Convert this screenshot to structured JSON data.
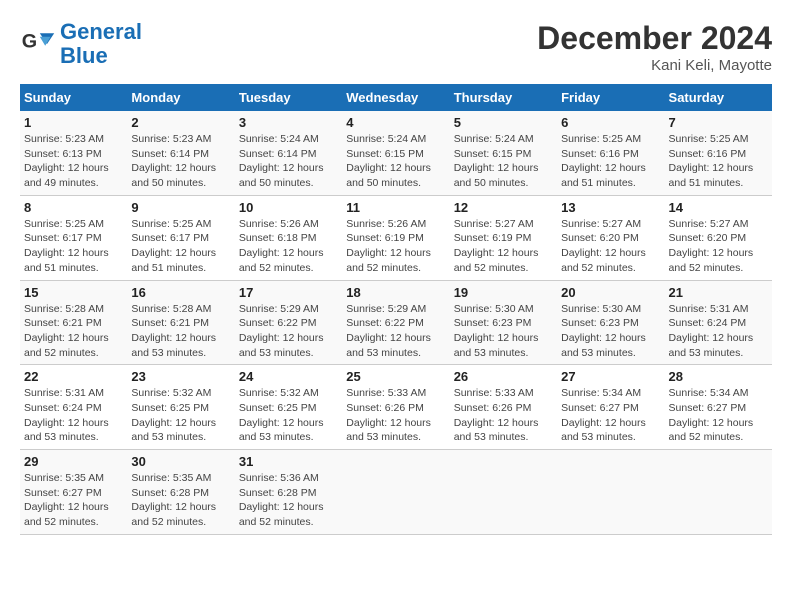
{
  "logo": {
    "line1": "General",
    "line2": "Blue"
  },
  "title": "December 2024",
  "subtitle": "Kani Keli, Mayotte",
  "headers": [
    "Sunday",
    "Monday",
    "Tuesday",
    "Wednesday",
    "Thursday",
    "Friday",
    "Saturday"
  ],
  "weeks": [
    [
      {
        "day": "1",
        "info": "Sunrise: 5:23 AM\nSunset: 6:13 PM\nDaylight: 12 hours\nand 49 minutes."
      },
      {
        "day": "2",
        "info": "Sunrise: 5:23 AM\nSunset: 6:14 PM\nDaylight: 12 hours\nand 50 minutes."
      },
      {
        "day": "3",
        "info": "Sunrise: 5:24 AM\nSunset: 6:14 PM\nDaylight: 12 hours\nand 50 minutes."
      },
      {
        "day": "4",
        "info": "Sunrise: 5:24 AM\nSunset: 6:15 PM\nDaylight: 12 hours\nand 50 minutes."
      },
      {
        "day": "5",
        "info": "Sunrise: 5:24 AM\nSunset: 6:15 PM\nDaylight: 12 hours\nand 50 minutes."
      },
      {
        "day": "6",
        "info": "Sunrise: 5:25 AM\nSunset: 6:16 PM\nDaylight: 12 hours\nand 51 minutes."
      },
      {
        "day": "7",
        "info": "Sunrise: 5:25 AM\nSunset: 6:16 PM\nDaylight: 12 hours\nand 51 minutes."
      }
    ],
    [
      {
        "day": "8",
        "info": "Sunrise: 5:25 AM\nSunset: 6:17 PM\nDaylight: 12 hours\nand 51 minutes."
      },
      {
        "day": "9",
        "info": "Sunrise: 5:25 AM\nSunset: 6:17 PM\nDaylight: 12 hours\nand 51 minutes."
      },
      {
        "day": "10",
        "info": "Sunrise: 5:26 AM\nSunset: 6:18 PM\nDaylight: 12 hours\nand 52 minutes."
      },
      {
        "day": "11",
        "info": "Sunrise: 5:26 AM\nSunset: 6:19 PM\nDaylight: 12 hours\nand 52 minutes."
      },
      {
        "day": "12",
        "info": "Sunrise: 5:27 AM\nSunset: 6:19 PM\nDaylight: 12 hours\nand 52 minutes."
      },
      {
        "day": "13",
        "info": "Sunrise: 5:27 AM\nSunset: 6:20 PM\nDaylight: 12 hours\nand 52 minutes."
      },
      {
        "day": "14",
        "info": "Sunrise: 5:27 AM\nSunset: 6:20 PM\nDaylight: 12 hours\nand 52 minutes."
      }
    ],
    [
      {
        "day": "15",
        "info": "Sunrise: 5:28 AM\nSunset: 6:21 PM\nDaylight: 12 hours\nand 52 minutes."
      },
      {
        "day": "16",
        "info": "Sunrise: 5:28 AM\nSunset: 6:21 PM\nDaylight: 12 hours\nand 53 minutes."
      },
      {
        "day": "17",
        "info": "Sunrise: 5:29 AM\nSunset: 6:22 PM\nDaylight: 12 hours\nand 53 minutes."
      },
      {
        "day": "18",
        "info": "Sunrise: 5:29 AM\nSunset: 6:22 PM\nDaylight: 12 hours\nand 53 minutes."
      },
      {
        "day": "19",
        "info": "Sunrise: 5:30 AM\nSunset: 6:23 PM\nDaylight: 12 hours\nand 53 minutes."
      },
      {
        "day": "20",
        "info": "Sunrise: 5:30 AM\nSunset: 6:23 PM\nDaylight: 12 hours\nand 53 minutes."
      },
      {
        "day": "21",
        "info": "Sunrise: 5:31 AM\nSunset: 6:24 PM\nDaylight: 12 hours\nand 53 minutes."
      }
    ],
    [
      {
        "day": "22",
        "info": "Sunrise: 5:31 AM\nSunset: 6:24 PM\nDaylight: 12 hours\nand 53 minutes."
      },
      {
        "day": "23",
        "info": "Sunrise: 5:32 AM\nSunset: 6:25 PM\nDaylight: 12 hours\nand 53 minutes."
      },
      {
        "day": "24",
        "info": "Sunrise: 5:32 AM\nSunset: 6:25 PM\nDaylight: 12 hours\nand 53 minutes."
      },
      {
        "day": "25",
        "info": "Sunrise: 5:33 AM\nSunset: 6:26 PM\nDaylight: 12 hours\nand 53 minutes."
      },
      {
        "day": "26",
        "info": "Sunrise: 5:33 AM\nSunset: 6:26 PM\nDaylight: 12 hours\nand 53 minutes."
      },
      {
        "day": "27",
        "info": "Sunrise: 5:34 AM\nSunset: 6:27 PM\nDaylight: 12 hours\nand 53 minutes."
      },
      {
        "day": "28",
        "info": "Sunrise: 5:34 AM\nSunset: 6:27 PM\nDaylight: 12 hours\nand 52 minutes."
      }
    ],
    [
      {
        "day": "29",
        "info": "Sunrise: 5:35 AM\nSunset: 6:27 PM\nDaylight: 12 hours\nand 52 minutes."
      },
      {
        "day": "30",
        "info": "Sunrise: 5:35 AM\nSunset: 6:28 PM\nDaylight: 12 hours\nand 52 minutes."
      },
      {
        "day": "31",
        "info": "Sunrise: 5:36 AM\nSunset: 6:28 PM\nDaylight: 12 hours\nand 52 minutes."
      },
      {
        "day": "",
        "info": ""
      },
      {
        "day": "",
        "info": ""
      },
      {
        "day": "",
        "info": ""
      },
      {
        "day": "",
        "info": ""
      }
    ]
  ]
}
